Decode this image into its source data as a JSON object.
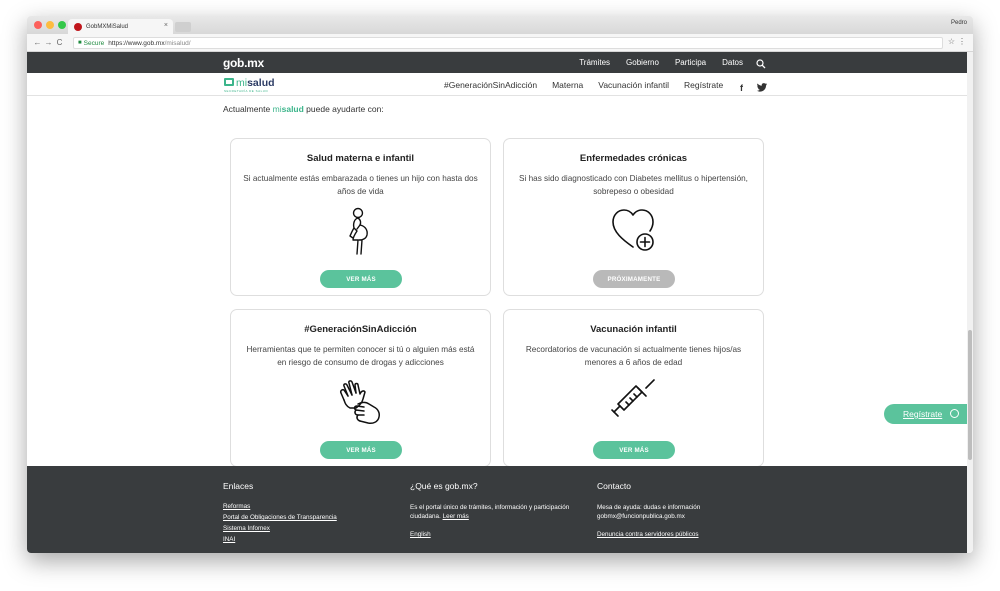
{
  "browser": {
    "tab_title": "GobMXMiSalud",
    "user": "Pedro",
    "secure_label": "Secure",
    "url_host": "https://www.gob.mx",
    "url_path": "/misalud/"
  },
  "gob_header": {
    "logo": "gob.mx",
    "nav": [
      "Trámites",
      "Gobierno",
      "Participa",
      "Datos"
    ]
  },
  "sub_header": {
    "logo_mi": "mi",
    "logo_salud": "salud",
    "logo_sub": "SECRETARÍA DE SALUD",
    "nav": [
      "#GeneraciónSinAdicción",
      "Materna",
      "Vacunación infantil",
      "Regístrate"
    ]
  },
  "intro": {
    "before": "Actualmente ",
    "mi": "mi",
    "salud": "salud",
    "after": " puede ayudarte con:"
  },
  "cards": [
    {
      "title": "Salud materna e infantil",
      "desc": "Si actualmente estás embarazada o tienes un hijo con hasta dos años de vida",
      "icon": "pregnant-woman-icon",
      "button": "VER MÁS"
    },
    {
      "title": "Enfermedades crónicas",
      "desc": "Si has sido diagnosticado con Diabetes mellitus o hipertensión, sobrepeso o obesidad",
      "icon": "heart-plus-icon",
      "button": "PRÓXIMAMENTE"
    },
    {
      "title": "#GeneraciónSinAdicción",
      "desc": "Herramientas que te permiten conocer si tú o alguien más está en riesgo de consumo de drogas y adicciones",
      "icon": "helping-hands-icon",
      "button": "VER MÁS"
    },
    {
      "title": "Vacunación infantil",
      "desc": "Recordatorios de vacunación si actualmente tienes hijos/as menores a 6 años de edad",
      "icon": "syringe-icon",
      "button": "VER MÁS"
    }
  ],
  "float_button": "Regístrate",
  "footer": {
    "enlaces_title": "Enlaces",
    "enlaces": [
      "Reformas",
      "Portal de Obligaciones de Transparencia",
      "Sistema Infomex",
      "INAI"
    ],
    "que_title": "¿Qué es gob.mx?",
    "que_text": "Es el portal único de trámites, información y participación ciudadana.",
    "que_link": "Leer más",
    "english": "English",
    "contacto_title": "Contacto",
    "contacto_text": "Mesa de ayuda: dudas e información gobmx@funcionpublica.gob.mx",
    "denuncia": "Denuncia contra servidores públicos"
  }
}
